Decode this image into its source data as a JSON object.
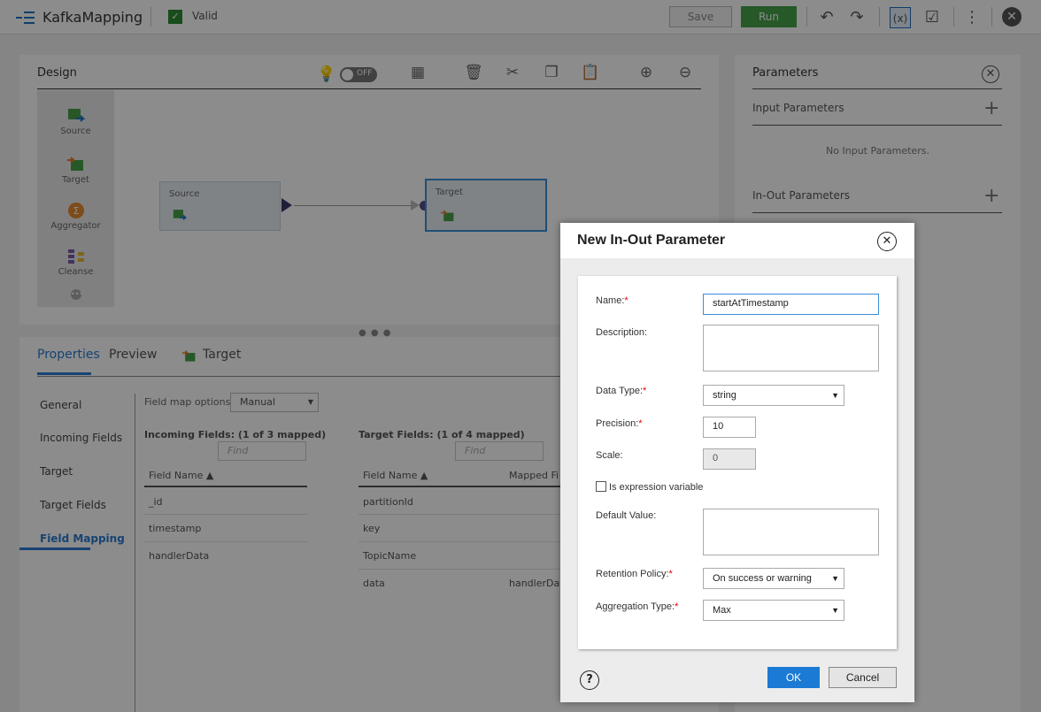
{
  "topbar": {
    "app_title": "KafkaMapping",
    "status_label": "Valid",
    "save_label": "Save",
    "run_label": "Run"
  },
  "design": {
    "title": "Design",
    "toggle_label": "OFF",
    "palette": [
      "Source",
      "Target",
      "Aggregator",
      "Cleanse"
    ],
    "nodes": {
      "source": "Source",
      "target": "Target"
    }
  },
  "properties": {
    "tabs": {
      "properties": "Properties",
      "preview": "Preview",
      "target": "Target"
    },
    "side_nav": [
      "General",
      "Incoming Fields",
      "Target",
      "Target Fields",
      "Field Mapping"
    ],
    "field_map_options_label": "Field map options:",
    "field_map_options_value": "Manual",
    "incoming_title": "Incoming Fields: (1 of 3 mapped)",
    "target_title": "Target Fields: (1 of 4 mapped)",
    "find_placeholder": "Find",
    "incoming_col": "Field Name ▲",
    "target_col": "Field Name ▲",
    "mapped_col": "Mapped Fi",
    "incoming_rows": [
      "_id",
      "timestamp",
      "handlerData"
    ],
    "target_rows": [
      "partitionId",
      "key",
      "TopicName",
      "data"
    ],
    "mapped_rows": [
      "",
      "",
      "",
      "handlerDat"
    ]
  },
  "parameters": {
    "title": "Parameters",
    "input_title": "Input Parameters",
    "input_empty": "No Input Parameters.",
    "inout_title": "In-Out Parameters"
  },
  "dialog": {
    "title": "New In-Out Parameter",
    "name_label": "Name:",
    "name_value": "startAtTimestamp",
    "description_label": "Description:",
    "data_type_label": "Data Type:",
    "data_type_value": "string",
    "precision_label": "Precision:",
    "precision_value": "10",
    "scale_label": "Scale:",
    "scale_value": "0",
    "expression_label": "Is expression variable",
    "default_label": "Default Value:",
    "retention_label": "Retention Policy:",
    "retention_value": "On success or warning",
    "aggregation_label": "Aggregation Type:",
    "aggregation_value": "Max",
    "required_mark": "*",
    "ok_label": "OK",
    "cancel_label": "Cancel"
  },
  "colors": {
    "accent": "#1a7ad4",
    "run_green": "#46a04a",
    "required_red": "#dd0000"
  }
}
